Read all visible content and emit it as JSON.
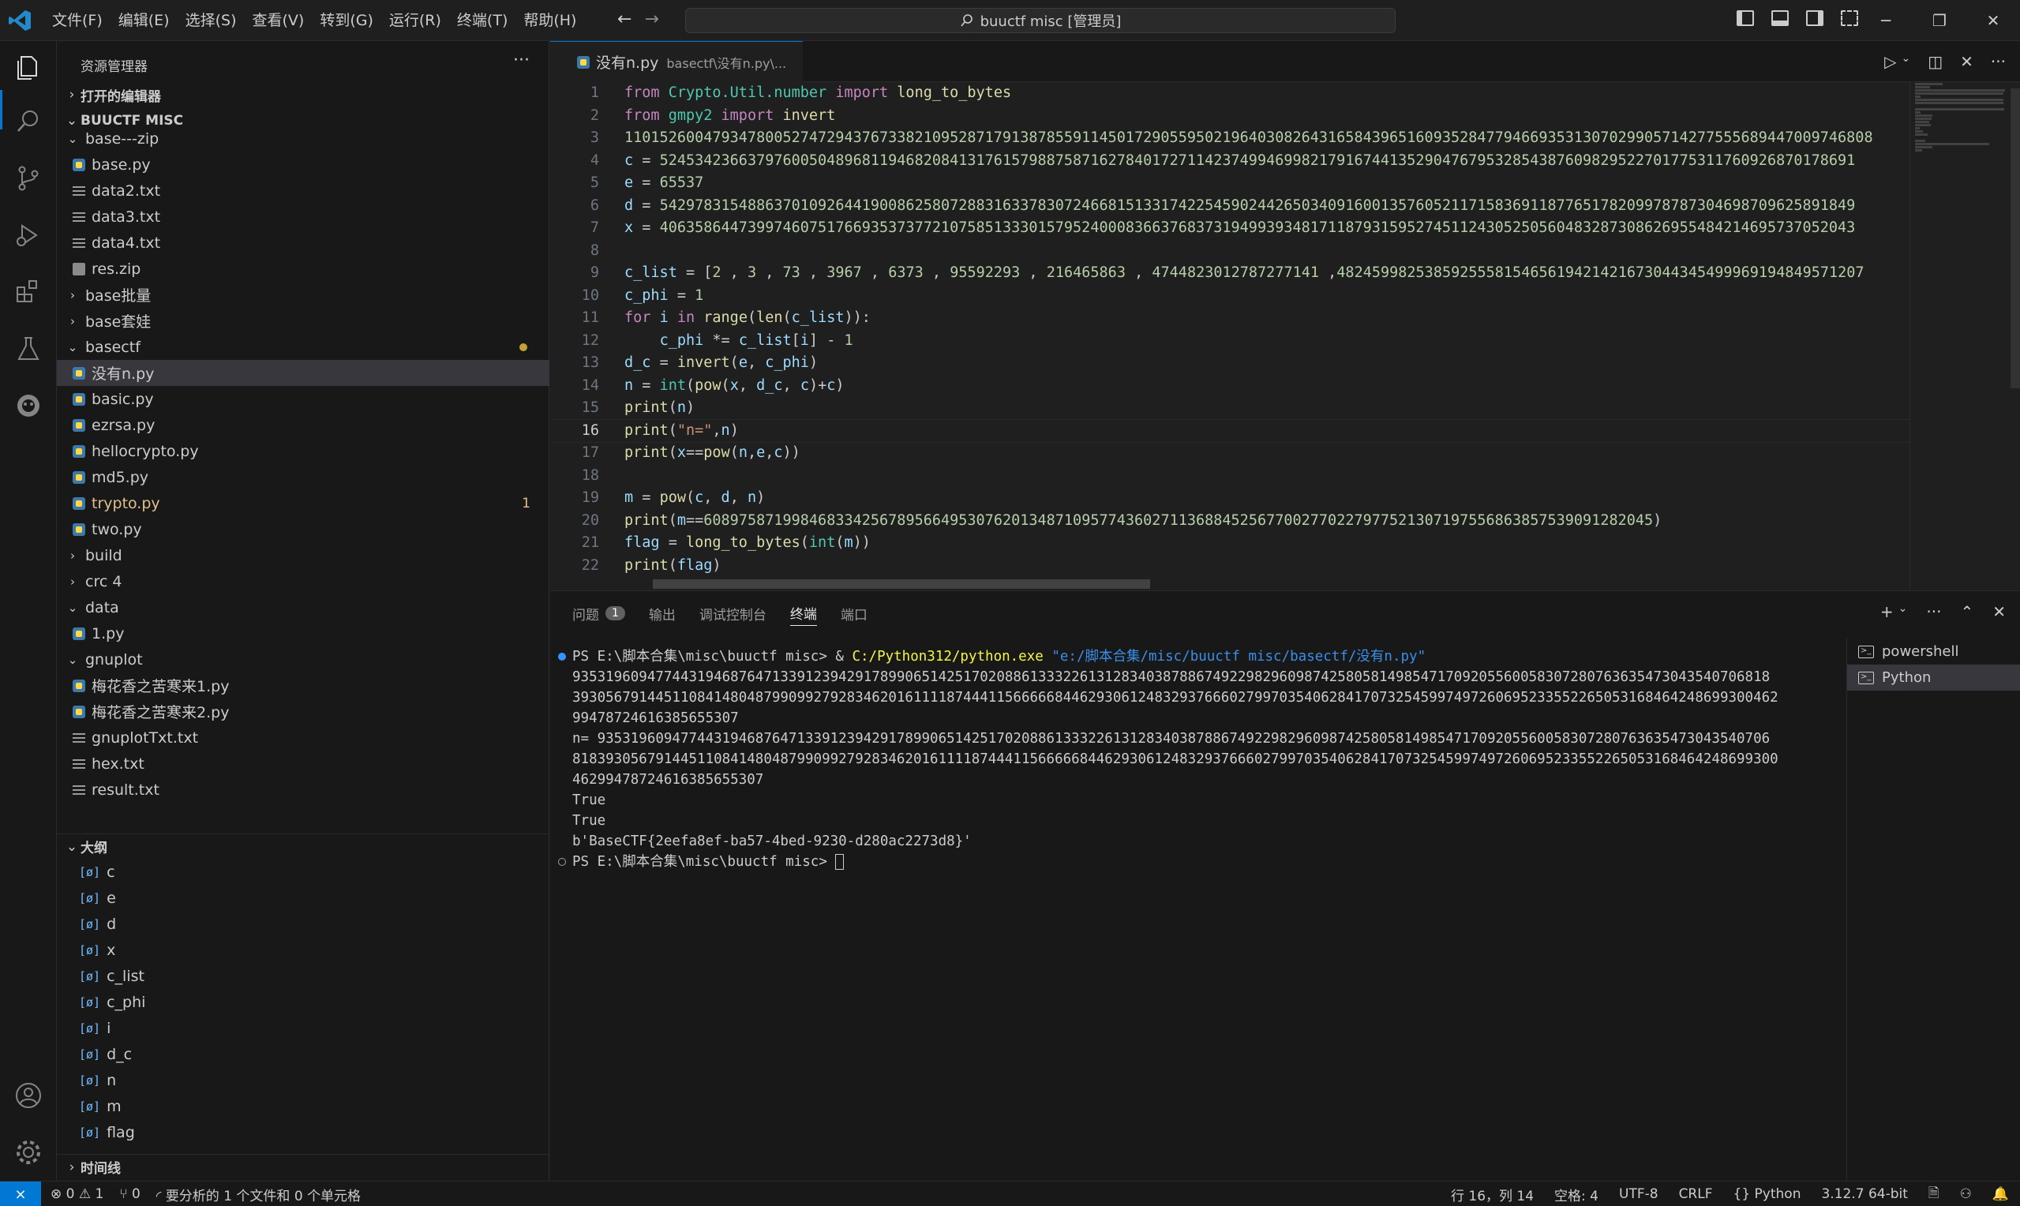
{
  "titlebar": {
    "menu": [
      "文件(F)",
      "编辑(E)",
      "选择(S)",
      "查看(V)",
      "转到(G)",
      "运行(R)",
      "终端(T)",
      "帮助(H)"
    ],
    "search": "buuctf misc [管理员]"
  },
  "sidebar": {
    "title": "资源管理器",
    "open_editors": "打开的编辑器",
    "workspace": "BUUCTF MISC",
    "tree": [
      {
        "label": "base---zip",
        "type": "folder-open",
        "depth": 1
      },
      {
        "label": "base.py",
        "type": "py",
        "depth": 2
      },
      {
        "label": "data2.txt",
        "type": "txt",
        "depth": 2
      },
      {
        "label": "data3.txt",
        "type": "txt",
        "depth": 2
      },
      {
        "label": "data4.txt",
        "type": "txt",
        "depth": 2
      },
      {
        "label": "res.zip",
        "type": "zip",
        "depth": 2
      },
      {
        "label": "base批量",
        "type": "folder",
        "depth": 1
      },
      {
        "label": "base套娃",
        "type": "folder",
        "depth": 1
      },
      {
        "label": "basectf",
        "type": "folder-open",
        "depth": 1,
        "modified": true
      },
      {
        "label": "没有n.py",
        "type": "py",
        "depth": 2,
        "selected": true
      },
      {
        "label": "basic.py",
        "type": "py",
        "depth": 2
      },
      {
        "label": "ezrsa.py",
        "type": "py",
        "depth": 2
      },
      {
        "label": "hellocrypto.py",
        "type": "py",
        "depth": 2
      },
      {
        "label": "md5.py",
        "type": "py",
        "depth": 2
      },
      {
        "label": "trypto.py",
        "type": "py",
        "depth": 2,
        "problems": "1"
      },
      {
        "label": "two.py",
        "type": "py",
        "depth": 2
      },
      {
        "label": "build",
        "type": "folder",
        "depth": 1
      },
      {
        "label": "crc 4",
        "type": "folder",
        "depth": 1
      },
      {
        "label": "data",
        "type": "folder-open",
        "depth": 1
      },
      {
        "label": "1.py",
        "type": "py",
        "depth": 2
      },
      {
        "label": "gnuplot",
        "type": "folder-open",
        "depth": 1
      },
      {
        "label": "梅花香之苦寒来1.py",
        "type": "py",
        "depth": 2
      },
      {
        "label": "梅花香之苦寒来2.py",
        "type": "py",
        "depth": 2
      },
      {
        "label": "gnuplotTxt.txt",
        "type": "txt",
        "depth": 2
      },
      {
        "label": "hex.txt",
        "type": "txt",
        "depth": 2
      },
      {
        "label": "result.txt",
        "type": "txt",
        "depth": 2
      }
    ],
    "outline_title": "大纲",
    "outline": [
      "c",
      "e",
      "d",
      "x",
      "c_list",
      "c_phi",
      "i",
      "d_c",
      "n",
      "m",
      "flag"
    ],
    "timeline": "时间线"
  },
  "editor": {
    "tab_label": "没有n.py",
    "tab_path": "basectf\\没有n.py\\...",
    "current_line": 16,
    "lines": [
      [
        [
          "kw",
          "from "
        ],
        [
          "mod",
          "Crypto.Util.number "
        ],
        [
          "kw",
          "import "
        ],
        [
          "fn",
          "long_to_bytes"
        ]
      ],
      [
        [
          "kw",
          "from "
        ],
        [
          "mod",
          "gmpy2 "
        ],
        [
          "kw",
          "import "
        ],
        [
          "fn",
          "invert"
        ]
      ],
      [
        [
          "num",
          "1101526004793478005274729437673382109528717913878559114501729055950219640308264316584396516093528477946693531307029905714277555689447009746808"
        ]
      ],
      [
        [
          "var",
          "c "
        ],
        [
          "plain",
          "= "
        ],
        [
          "num",
          "5245342366379760050489681194682084131761579887587162784017271142374994699821791674413529047679532854387609829522701775311760926870178691"
        ]
      ],
      [
        [
          "var",
          "e "
        ],
        [
          "plain",
          "= "
        ],
        [
          "num",
          "65537"
        ]
      ],
      [
        [
          "var",
          "d "
        ],
        [
          "plain",
          "= "
        ],
        [
          "num",
          "5429783154886370109264419008625807288316337830724668151331742254590244265034091600135760521171583691187765178209978787304698709625891849"
        ]
      ],
      [
        [
          "var",
          "x "
        ],
        [
          "plain",
          "= "
        ],
        [
          "num",
          "4063586447399746075176693537377210758513330157952400083663768373194993934817118793159527451124305250560483287308626955484214695737052043"
        ]
      ],
      [],
      [
        [
          "var",
          "c_list "
        ],
        [
          "plain",
          "= ["
        ],
        [
          "num",
          "2"
        ],
        [
          "plain",
          " , "
        ],
        [
          "num",
          "3"
        ],
        [
          "plain",
          " , "
        ],
        [
          "num",
          "73"
        ],
        [
          "plain",
          " , "
        ],
        [
          "num",
          "3967"
        ],
        [
          "plain",
          " , "
        ],
        [
          "num",
          "6373"
        ],
        [
          "plain",
          " , "
        ],
        [
          "num",
          "95592293"
        ],
        [
          "plain",
          " , "
        ],
        [
          "num",
          "216465863"
        ],
        [
          "plain",
          " , "
        ],
        [
          "num",
          "4744823012787277141"
        ],
        [
          "plain",
          " ,"
        ],
        [
          "num",
          "482459982538592555815465619421421673044345499969194849571207"
        ]
      ],
      [
        [
          "var",
          "c_phi "
        ],
        [
          "plain",
          "= "
        ],
        [
          "num",
          "1"
        ]
      ],
      [
        [
          "kw",
          "for "
        ],
        [
          "var",
          "i "
        ],
        [
          "kw",
          "in "
        ],
        [
          "fn",
          "range"
        ],
        [
          "plain",
          "("
        ],
        [
          "fn",
          "len"
        ],
        [
          "plain",
          "("
        ],
        [
          "var",
          "c_list"
        ],
        [
          "plain",
          "))"
        ],
        [
          "plain",
          ":"
        ]
      ],
      [
        [
          "plain",
          "    "
        ],
        [
          "var",
          "c_phi "
        ],
        [
          "plain",
          "*= "
        ],
        [
          "var",
          "c_list"
        ],
        [
          "plain",
          "["
        ],
        [
          "var",
          "i"
        ],
        [
          "plain",
          "] - "
        ],
        [
          "num",
          "1"
        ]
      ],
      [
        [
          "var",
          "d_c "
        ],
        [
          "plain",
          "= "
        ],
        [
          "fn",
          "invert"
        ],
        [
          "plain",
          "("
        ],
        [
          "var",
          "e"
        ],
        [
          "plain",
          ", "
        ],
        [
          "var",
          "c_phi"
        ],
        [
          "plain",
          ")"
        ]
      ],
      [
        [
          "var",
          "n "
        ],
        [
          "plain",
          "= "
        ],
        [
          "mod",
          "int"
        ],
        [
          "plain",
          "("
        ],
        [
          "fn",
          "pow"
        ],
        [
          "plain",
          "("
        ],
        [
          "var",
          "x"
        ],
        [
          "plain",
          ", "
        ],
        [
          "var",
          "d_c"
        ],
        [
          "plain",
          ", "
        ],
        [
          "var",
          "c"
        ],
        [
          "plain",
          ")+"
        ],
        [
          "var",
          "c"
        ],
        [
          "plain",
          ")"
        ]
      ],
      [
        [
          "fn",
          "print"
        ],
        [
          "plain",
          "("
        ],
        [
          "var",
          "n"
        ],
        [
          "plain",
          ")"
        ]
      ],
      [
        [
          "fn",
          "print"
        ],
        [
          "plain",
          "("
        ],
        [
          "str",
          "\"n=\""
        ],
        [
          "plain",
          ","
        ],
        [
          "var",
          "n"
        ],
        [
          "plain",
          ")"
        ]
      ],
      [
        [
          "fn",
          "print"
        ],
        [
          "plain",
          "("
        ],
        [
          "var",
          "x"
        ],
        [
          "plain",
          "=="
        ],
        [
          "fn",
          "pow"
        ],
        [
          "plain",
          "("
        ],
        [
          "var",
          "n"
        ],
        [
          "plain",
          ","
        ],
        [
          "var",
          "e"
        ],
        [
          "plain",
          ","
        ],
        [
          "var",
          "c"
        ],
        [
          "plain",
          "))"
        ]
      ],
      [],
      [
        [
          "var",
          "m "
        ],
        [
          "plain",
          "= "
        ],
        [
          "fn",
          "pow"
        ],
        [
          "plain",
          "("
        ],
        [
          "var",
          "c"
        ],
        [
          "plain",
          ", "
        ],
        [
          "var",
          "d"
        ],
        [
          "plain",
          ", "
        ],
        [
          "var",
          "n"
        ],
        [
          "plain",
          ")"
        ]
      ],
      [
        [
          "fn",
          "print"
        ],
        [
          "plain",
          "("
        ],
        [
          "var",
          "m"
        ],
        [
          "plain",
          "=="
        ],
        [
          "num",
          "608975871998468334256789566495307620134871095774360271136884525677002770227977521307197556863857539091282045"
        ],
        [
          "plain",
          ")"
        ]
      ],
      [
        [
          "var",
          "flag "
        ],
        [
          "plain",
          "= "
        ],
        [
          "fn",
          "long_to_bytes"
        ],
        [
          "plain",
          "("
        ],
        [
          "mod",
          "int"
        ],
        [
          "plain",
          "("
        ],
        [
          "var",
          "m"
        ],
        [
          "plain",
          "))"
        ]
      ],
      [
        [
          "fn",
          "print"
        ],
        [
          "plain",
          "("
        ],
        [
          "var",
          "flag"
        ],
        [
          "plain",
          ")"
        ]
      ]
    ]
  },
  "panel": {
    "tabs": [
      "问题",
      "输出",
      "调试控制台",
      "终端",
      "端口"
    ],
    "problem_count": "1",
    "active_tab": "终端",
    "prompt_cmd_prefix": "PS E:\\脚本合集\\misc\\buuctf misc> & ",
    "python_path": "C:/Python312/python.exe",
    "script_arg": "\"e:/脚本合集/misc/buuctf misc/basectf/没有n.py\"",
    "output": [
      "935319609477443194687647133912394291789906514251702088613332261312834038788674922982960987425805814985471709205560058307280763635473043540706818",
      "393056791445110841480487990992792834620161111874441156666684462930612483293766602799703540628417073254599749726069523355226505316846424869930046​2",
      "99478724616385655307",
      "n= 935319609477443194687647133912394291789906514251702088613332261312834038788674922982960987425805814985471709205560058307280763635473043540706",
      "818393056791445110841480487990992792834620161111874441156666684462930612483293766602799703540628417073254599749726069523355226505316846424869930​0",
      "46299478724616385655307",
      "True",
      "True",
      "b'BaseCTF{2eefa8ef-ba57-4bed-9230-d280ac2273d8}'"
    ],
    "final_prompt": "PS E:\\脚本合集\\misc\\buuctf misc> ",
    "terminals": [
      "powershell",
      "Python"
    ]
  },
  "status": {
    "errors": "0",
    "warnings": "1",
    "ports": "0",
    "analysis": "要分析的 1 个文件和 0 个单元格",
    "position": "行 16，列 14",
    "spaces": "空格: 4",
    "encoding": "UTF-8",
    "eol": "CRLF",
    "language": "Python",
    "interpreter": "3.12.7 64-bit"
  }
}
